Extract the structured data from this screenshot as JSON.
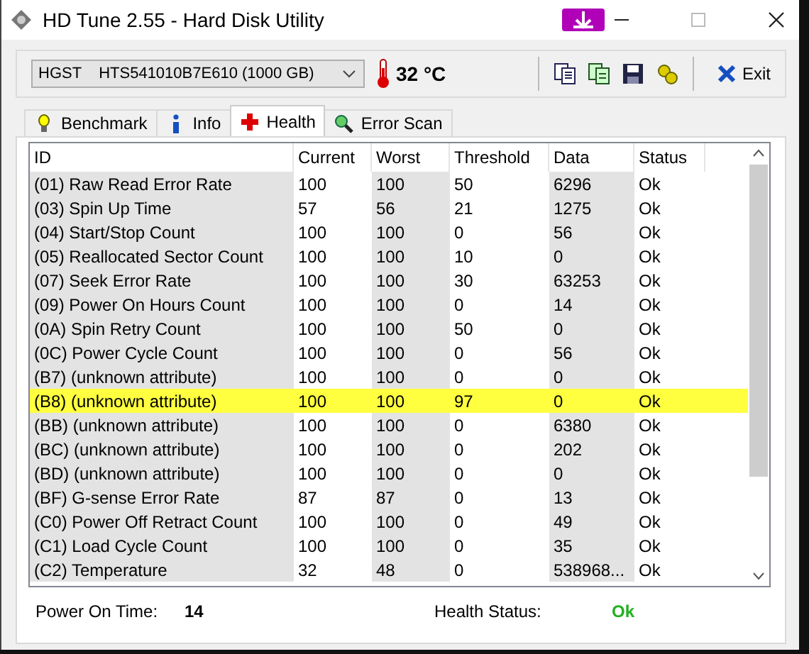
{
  "window": {
    "title": "HD Tune 2.55 - Hard Disk Utility"
  },
  "toolbar": {
    "drive": "HGST    HTS541010B7E610 (1000 GB)",
    "temperature": "32 °C",
    "exit_label": "Exit"
  },
  "tabs": [
    {
      "label": "Benchmark",
      "selected": false
    },
    {
      "label": "Info",
      "selected": false
    },
    {
      "label": "Health",
      "selected": true
    },
    {
      "label": "Error Scan",
      "selected": false
    }
  ],
  "table": {
    "columns": [
      "ID",
      "Current",
      "Worst",
      "Threshold",
      "Data",
      "Status"
    ],
    "rows": [
      {
        "cells": [
          "(01) Raw Read Error Rate",
          "100",
          "100",
          "50",
          "6296",
          "Ok"
        ],
        "selected": false
      },
      {
        "cells": [
          "(03) Spin Up Time",
          "57",
          "56",
          "21",
          "1275",
          "Ok"
        ],
        "selected": false
      },
      {
        "cells": [
          "(04) Start/Stop Count",
          "100",
          "100",
          "0",
          "56",
          "Ok"
        ],
        "selected": false
      },
      {
        "cells": [
          "(05) Reallocated Sector Count",
          "100",
          "100",
          "10",
          "0",
          "Ok"
        ],
        "selected": false
      },
      {
        "cells": [
          "(07) Seek Error Rate",
          "100",
          "100",
          "30",
          "63253",
          "Ok"
        ],
        "selected": false
      },
      {
        "cells": [
          "(09) Power On Hours Count",
          "100",
          "100",
          "0",
          "14",
          "Ok"
        ],
        "selected": false
      },
      {
        "cells": [
          "(0A) Spin Retry Count",
          "100",
          "100",
          "50",
          "0",
          "Ok"
        ],
        "selected": false
      },
      {
        "cells": [
          "(0C) Power Cycle Count",
          "100",
          "100",
          "0",
          "56",
          "Ok"
        ],
        "selected": false
      },
      {
        "cells": [
          "(B7) (unknown attribute)",
          "100",
          "100",
          "0",
          "0",
          "Ok"
        ],
        "selected": false
      },
      {
        "cells": [
          "(B8) (unknown attribute)",
          "100",
          "100",
          "97",
          "0",
          "Ok"
        ],
        "selected": true
      },
      {
        "cells": [
          "(BB) (unknown attribute)",
          "100",
          "100",
          "0",
          "6380",
          "Ok"
        ],
        "selected": false
      },
      {
        "cells": [
          "(BC) (unknown attribute)",
          "100",
          "100",
          "0",
          "202",
          "Ok"
        ],
        "selected": false
      },
      {
        "cells": [
          "(BD) (unknown attribute)",
          "100",
          "100",
          "0",
          "0",
          "Ok"
        ],
        "selected": false
      },
      {
        "cells": [
          "(BF) G-sense Error Rate",
          "87",
          "87",
          "0",
          "13",
          "Ok"
        ],
        "selected": false
      },
      {
        "cells": [
          "(C0) Power Off Retract Count",
          "100",
          "100",
          "0",
          "49",
          "Ok"
        ],
        "selected": false
      },
      {
        "cells": [
          "(C1) Load Cycle Count",
          "100",
          "100",
          "0",
          "35",
          "Ok"
        ],
        "selected": false
      },
      {
        "cells": [
          "(C2) Temperature",
          "32",
          "48",
          "0",
          "538968...",
          "Ok"
        ],
        "selected": false
      }
    ]
  },
  "status_bar": {
    "power_on_label": "Power On Time:",
    "power_on_value": "14",
    "health_label": "Health Status:",
    "health_value": "Ok"
  }
}
